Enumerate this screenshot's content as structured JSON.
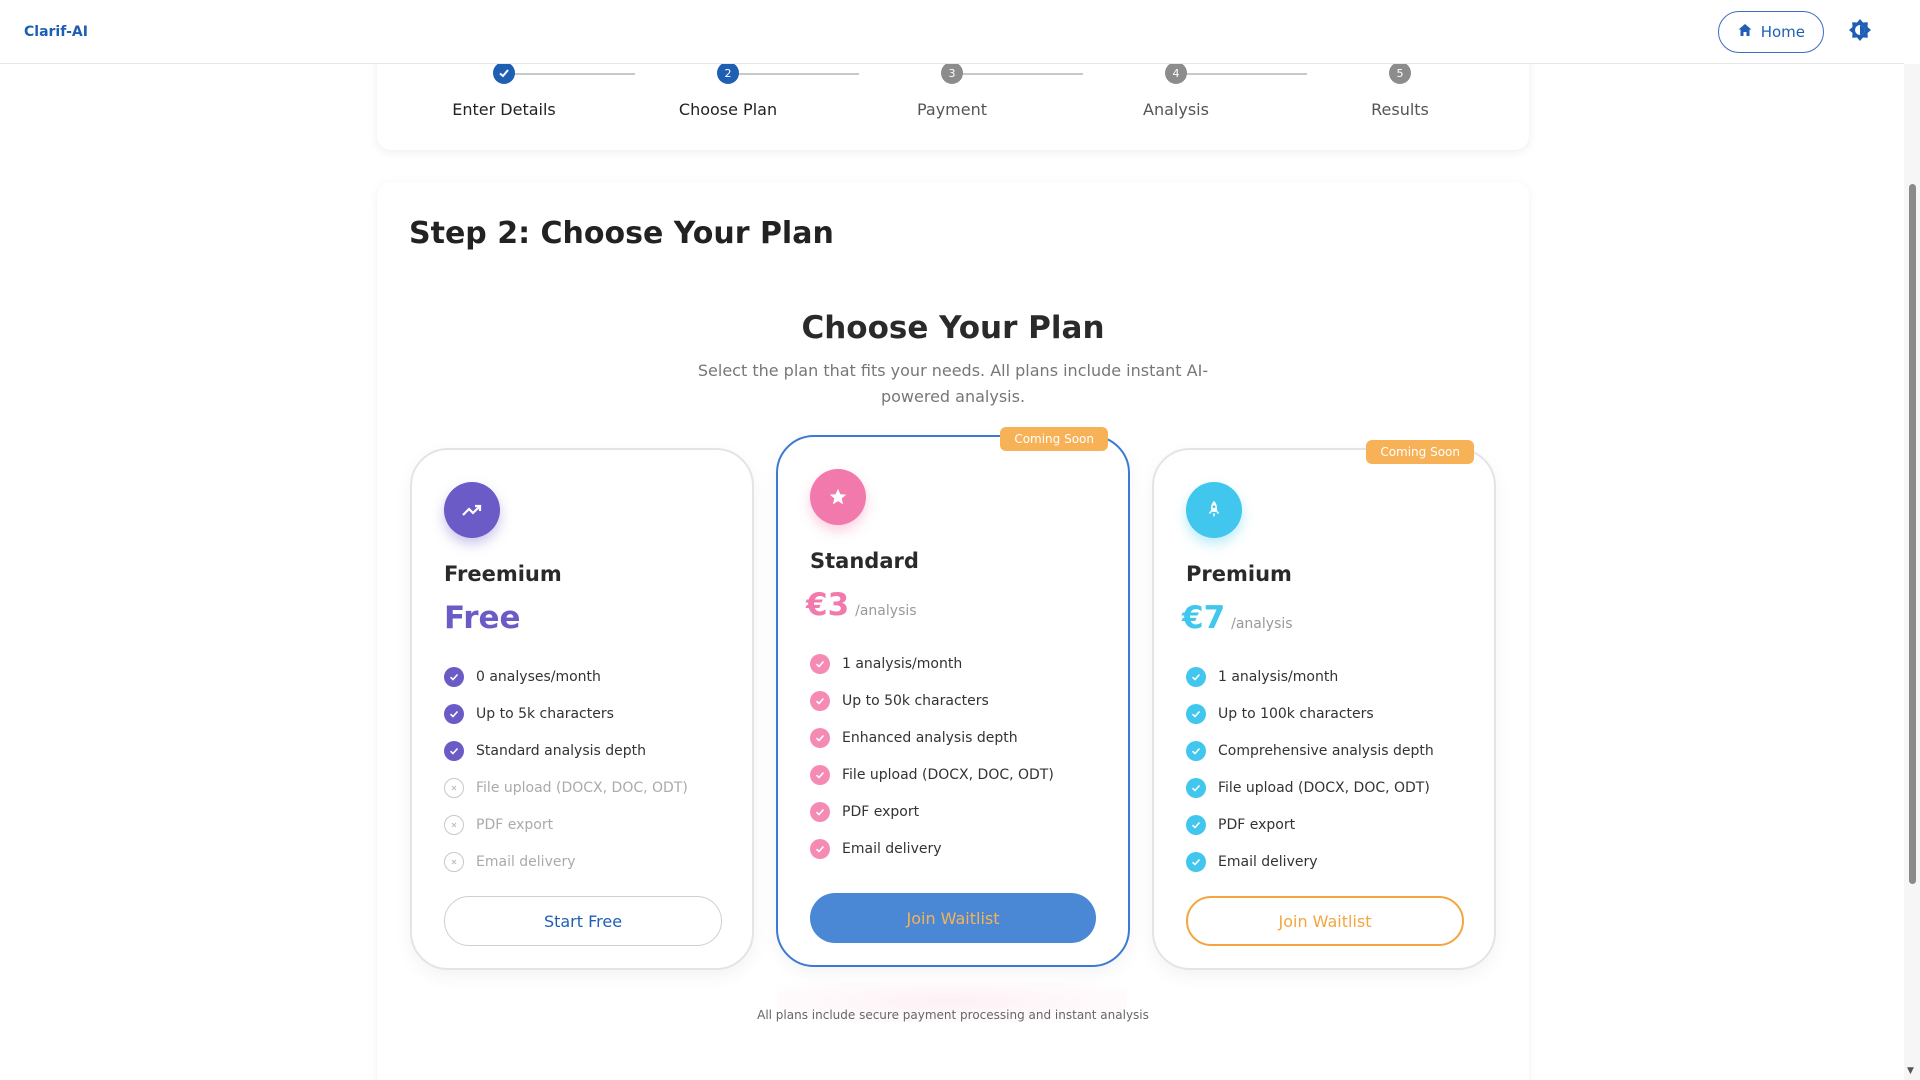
{
  "header": {
    "brand": "Clarif-AI",
    "home_label": "Home"
  },
  "stepper": {
    "steps": [
      {
        "num": "✓",
        "label": "Enter Details"
      },
      {
        "num": "2",
        "label": "Choose Plan"
      },
      {
        "num": "3",
        "label": "Payment"
      },
      {
        "num": "4",
        "label": "Analysis"
      },
      {
        "num": "5",
        "label": "Results"
      }
    ]
  },
  "main": {
    "step_title": "Step 2: Choose Your Plan",
    "section_title": "Choose Your Plan",
    "section_subtitle": "Select the plan that fits your needs. All plans include instant AI-powered analysis.",
    "footnote": "All plans include secure payment processing and instant analysis"
  },
  "plans": [
    {
      "name": "Freemium",
      "price": "Free",
      "unit": "",
      "badge": "",
      "button": "Start Free",
      "features": [
        {
          "text": "0 analyses/month",
          "included": true
        },
        {
          "text": "Up to 5k characters",
          "included": true
        },
        {
          "text": "Standard analysis depth",
          "included": true
        },
        {
          "text": "File upload (DOCX, DOC, ODT)",
          "included": false
        },
        {
          "text": "PDF export",
          "included": false
        },
        {
          "text": "Email delivery",
          "included": false
        }
      ]
    },
    {
      "name": "Standard",
      "price": "€3",
      "unit": "/analysis",
      "badge": "Coming Soon",
      "button": "Join Waitlist",
      "features": [
        {
          "text": "1 analysis/month",
          "included": true
        },
        {
          "text": "Up to 50k characters",
          "included": true
        },
        {
          "text": "Enhanced analysis depth",
          "included": true
        },
        {
          "text": "File upload (DOCX, DOC, ODT)",
          "included": true
        },
        {
          "text": "PDF export",
          "included": true
        },
        {
          "text": "Email delivery",
          "included": true
        }
      ]
    },
    {
      "name": "Premium",
      "price": "€7",
      "unit": "/analysis",
      "badge": "Coming Soon",
      "button": "Join Waitlist",
      "features": [
        {
          "text": "1 analysis/month",
          "included": true
        },
        {
          "text": "Up to 100k characters",
          "included": true
        },
        {
          "text": "Comprehensive analysis depth",
          "included": true
        },
        {
          "text": "File upload (DOCX, DOC, ODT)",
          "included": true
        },
        {
          "text": "PDF export",
          "included": true
        },
        {
          "text": "Email delivery",
          "included": true
        }
      ]
    }
  ],
  "colors": {
    "primary": "#1e5fb4",
    "freemium": "#6a5bc6",
    "standard": "#f279ab",
    "premium": "#41c6ee",
    "badge": "#f7b257"
  }
}
